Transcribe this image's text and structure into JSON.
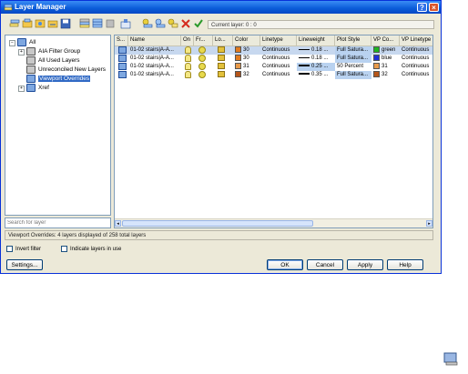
{
  "window": {
    "title": "Layer Manager"
  },
  "toolbar": {
    "current_layer_label": "Current layer: 0 : 0"
  },
  "tree": {
    "nodes": [
      {
        "label": "All"
      },
      {
        "label": "AIA Filter Group"
      },
      {
        "label": "All Used Layers"
      },
      {
        "label": "Unreconciled New Layers"
      },
      {
        "label": "Viewport Overrides"
      },
      {
        "label": "Xref"
      }
    ]
  },
  "search": {
    "placeholder": "Search for layer"
  },
  "table": {
    "columns": [
      "S...",
      "Name",
      "On",
      "Fr...",
      "Lo...",
      "Color",
      "Linetype",
      "Lineweight",
      "Plot Style",
      "VP Co...",
      "VP Linetype"
    ],
    "rows": [
      {
        "name": "01-02 stairs|A-A...",
        "color_num": "30",
        "color": "#e07a1f",
        "linetype": "Continuous",
        "lineweight": "0.18 ...",
        "plot_style": "Full Satura...",
        "vp_color_name": "green",
        "vp_color": "#1fb51f",
        "vp_linetype": "Continuous"
      },
      {
        "name": "01-02 stairs|A-A...",
        "color_num": "30",
        "color": "#e07a1f",
        "linetype": "Continuous",
        "lineweight": "0.18 ...",
        "plot_style": "Full Satura...",
        "vp_color_name": "blue",
        "vp_color": "#1f2fd9",
        "vp_linetype": "Continuous"
      },
      {
        "name": "01-02 stairs|A-A...",
        "color_num": "31",
        "color": "#e89a4a",
        "linetype": "Continuous",
        "lineweight": "0.25 ...",
        "plot_style": "50 Percent",
        "vp_color_name": "31",
        "vp_color": "#e89a4a",
        "vp_linetype": "Continuous"
      },
      {
        "name": "01-02 stairs|A-A...",
        "color_num": "32",
        "color": "#b5551a",
        "linetype": "Continuous",
        "lineweight": "0.35 ...",
        "plot_style": "Full Satura...",
        "vp_color_name": "32",
        "vp_color": "#b5551a",
        "vp_linetype": "Continuous"
      }
    ]
  },
  "statusbar": {
    "text": "Viewport Overrides: 4 layers displayed of 258 total layers"
  },
  "options": {
    "invert_filter": "Invert filter",
    "indicate_in_use": "Indicate layers in use"
  },
  "buttons": {
    "settings": "Settings...",
    "ok": "OK",
    "cancel": "Cancel",
    "apply": "Apply",
    "help": "Help"
  },
  "colors": {
    "selection": "#316ac5",
    "title_bar": "#0a5bd8"
  }
}
